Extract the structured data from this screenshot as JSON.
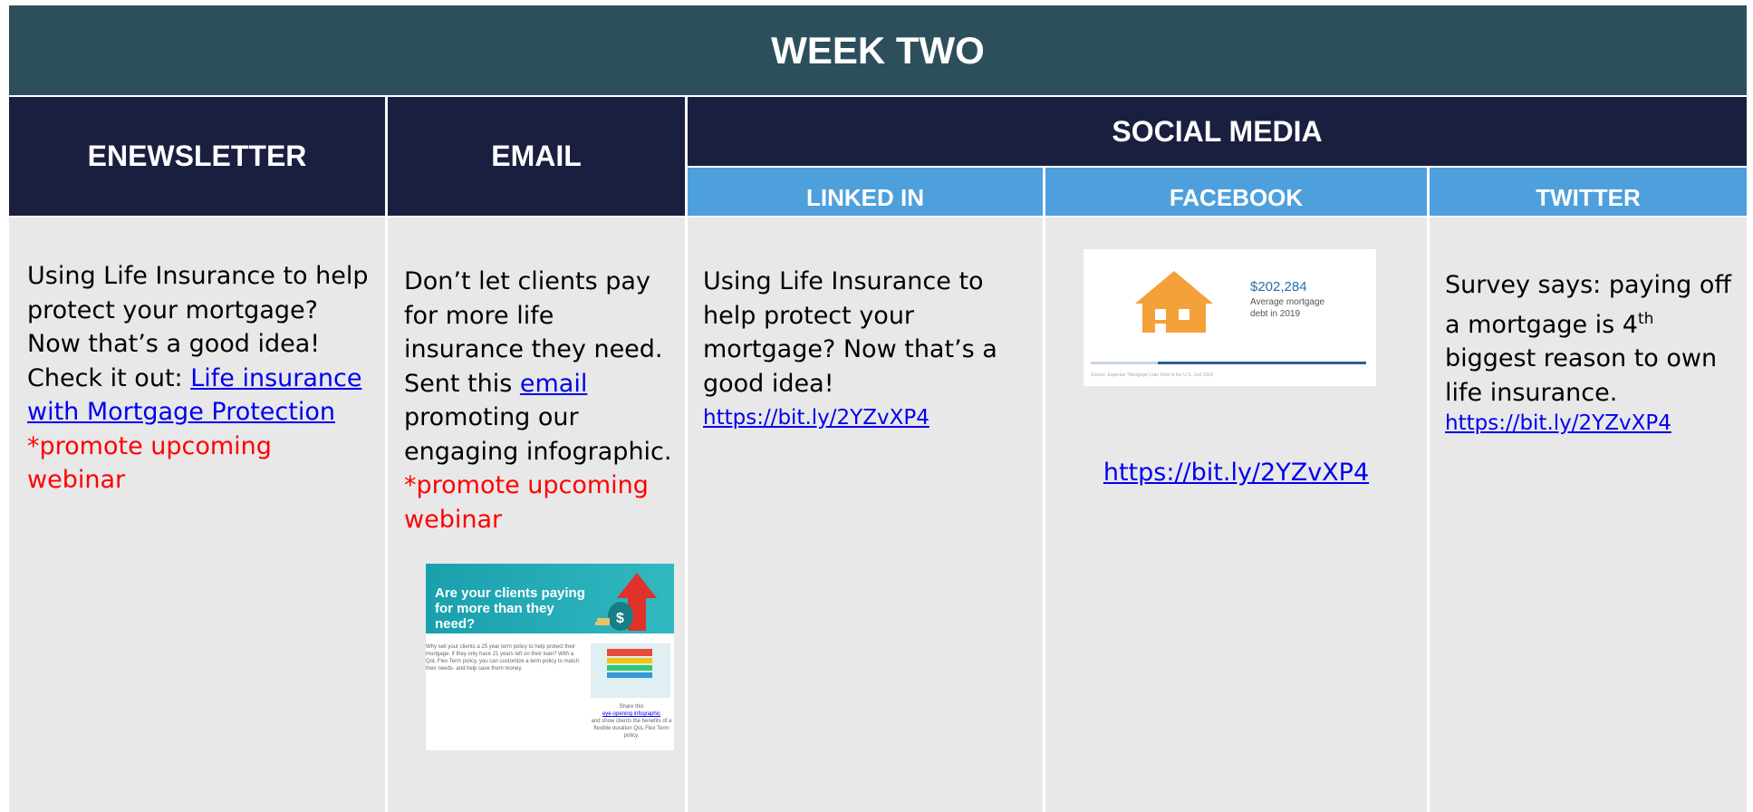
{
  "title": "WEEK TWO",
  "headers": {
    "enewsletter": "ENEWSLETTER",
    "email": "EMAIL",
    "social_media": "SOCIAL MEDIA",
    "linkedin": "LINKED IN",
    "facebook": "FACEBOOK",
    "twitter": "TWITTER"
  },
  "enewsletter": {
    "text": "Using Life Insurance to help protect your mortgage? Now that’s a good idea! Check it out: ",
    "link_text": "Life insurance with Mortgage Protection",
    "promo": "*promote upcoming webinar"
  },
  "email": {
    "text": "Don’t let clients pay for more life insurance they need. Sent this ",
    "link_text": "email",
    "text_after": " promoting our engaging infographic.",
    "promo": "*promote upcoming webinar",
    "thumbnail": {
      "headline": "Are your clients paying for more than they need?",
      "body": "Why sell your clients a 25 year term policy to help protect their mortgage, if they only have 21 years left on their loan? With a QoL Flex Term policy, you can customize a term policy to match their needs- and help save them money.",
      "caption_pre": "Share this",
      "caption_link": "eye-opening infographic",
      "caption_post": "and show clients the benefits of a flexible duration QoL Flex Term policy."
    }
  },
  "linkedin": {
    "text": "Using Life Insurance to help protect your mortgage? Now that’s a good idea!",
    "link": "https://bit.ly/2YZvXP4"
  },
  "facebook": {
    "image": {
      "amount": "$202,284",
      "caption": "Average mortgage debt in 2019",
      "source": "Source: Experian \"Mortgage Loan Debt in the U.S. Just 2019"
    },
    "link": "https://bit.ly/2YZvXP4"
  },
  "twitter": {
    "text_pre": "Survey says: paying off a mortgage is 4",
    "sup": "th",
    "text_post": " biggest reason to own life insurance.",
    "link": "https://bit.ly/2YZvXP4"
  },
  "colors": {
    "title_bg": "#2d4f5c",
    "header_bg": "#1b1f3f",
    "subheader_bg": "#4ea0dc",
    "cell_bg": "#e8e8e8",
    "link": "#0000ee",
    "promo": "#ff0000"
  }
}
